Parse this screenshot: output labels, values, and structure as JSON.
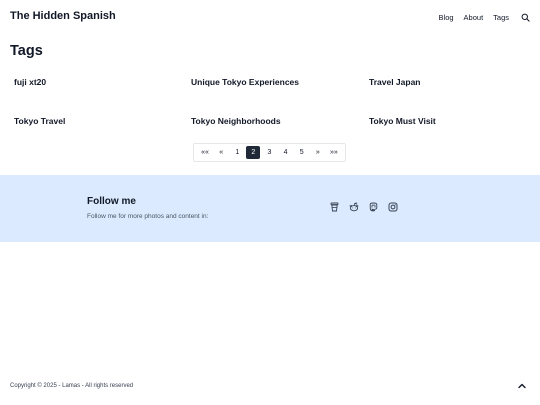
{
  "header": {
    "site_title": "The Hidden Spanish",
    "nav": [
      "Blog",
      "About",
      "Tags"
    ],
    "search_icon": "search-icon"
  },
  "main": {
    "page_title": "Tags",
    "tags": [
      "fuji xt20",
      "Unique Tokyo Experiences",
      "Travel Japan",
      "Tokyo Travel",
      "Tokyo Neighborhoods",
      "Tokyo Must Visit"
    ],
    "pagination": {
      "first": "««",
      "prev": "«",
      "pages": [
        "1",
        "2",
        "3",
        "4",
        "5"
      ],
      "current": "2",
      "next": "»",
      "last": "»»"
    }
  },
  "follow": {
    "title": "Follow me",
    "description": "Follow me for more photos and content in:",
    "icons": [
      "coffee-cup-icon",
      "reddit-icon",
      "mastodon-icon",
      "instagram-icon"
    ],
    "background": "#dbeafe"
  },
  "footer": {
    "copyright": "Copyright © 2025 - Lamas - All rights reserved",
    "to_top_icon": "caret-up-icon"
  }
}
